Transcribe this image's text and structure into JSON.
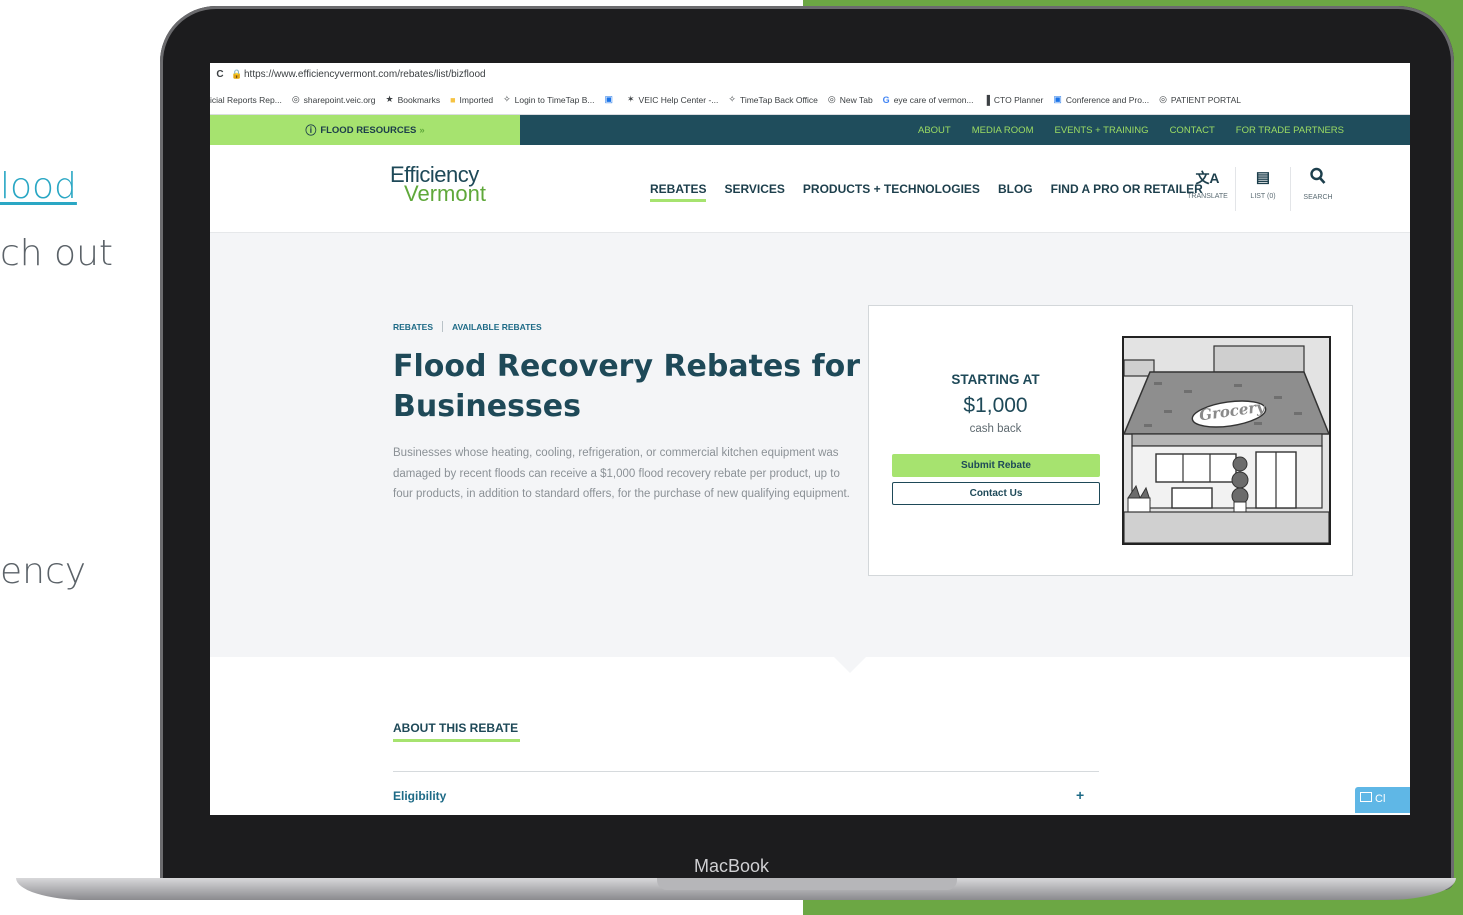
{
  "slide": {
    "line1": "lood",
    "line2": "ch out",
    "line3": "ency",
    "colors": {
      "accent": "#6ca744",
      "link": "#2aa7c4"
    }
  },
  "device": {
    "label": "MacBook"
  },
  "browser": {
    "url": "https://www.efficiencyvermont.com/rebates/list/bizflood",
    "bookmarks": [
      {
        "icon": "",
        "label": "icial Reports Rep..."
      },
      {
        "icon": "globe-icon",
        "label": "sharepoint.veic.org"
      },
      {
        "icon": "star-icon",
        "label": "Bookmarks"
      },
      {
        "icon": "folder-icon",
        "label": "Imported"
      },
      {
        "icon": "timetap-icon",
        "label": "Login to TimeTap B..."
      },
      {
        "icon": "app-icon",
        "label": ""
      },
      {
        "icon": "help-icon",
        "label": "VEIC Help Center -..."
      },
      {
        "icon": "timetap-icon",
        "label": "TimeTap Back Office"
      },
      {
        "icon": "globe-icon",
        "label": "New Tab"
      },
      {
        "icon": "google-icon",
        "label": "eye care of vermon..."
      },
      {
        "icon": "chart-icon",
        "label": "CTO Planner"
      },
      {
        "icon": "app-icon",
        "label": "Conference and Pro..."
      },
      {
        "icon": "globe-icon",
        "label": "PATIENT PORTAL"
      }
    ]
  },
  "site": {
    "flood_banner": "FLOOD RESOURCES",
    "utility_links": [
      "ABOUT",
      "MEDIA ROOM",
      "EVENTS + TRAINING",
      "CONTACT",
      "FOR TRADE PARTNERS"
    ],
    "logo": {
      "line1": "Efficiency",
      "line2": "Vermont"
    },
    "nav": [
      "REBATES",
      "SERVICES",
      "PRODUCTS + TECHNOLOGIES",
      "BLOG",
      "FIND A PRO OR RETAILER"
    ],
    "tools": [
      {
        "icon": "translate-icon",
        "label": "TRANSLATE"
      },
      {
        "icon": "clipboard-icon",
        "label": "LIST (0)"
      },
      {
        "icon": "search-icon",
        "label": "SEARCH"
      }
    ],
    "breadcrumb": [
      "REBATES",
      "AVAILABLE REBATES"
    ],
    "hero": {
      "title": "Flood Recovery Rebates for Businesses",
      "description": "Businesses whose heating, cooling, refrigeration, or commercial kitchen equipment was damaged by recent floods can receive a $1,000 flood recovery rebate per product, up to four products, in addition to standard offers, for the purchase of new qualifying equipment."
    },
    "card": {
      "starting_label": "STARTING AT",
      "price": "$1,000",
      "price_note": "cash back",
      "submit_label": "Submit Rebate",
      "contact_label": "Contact Us",
      "store_sign": "Grocery"
    },
    "about_heading": "ABOUT THIS REBATE",
    "accordion": [
      {
        "label": "Eligibility",
        "toggle": "+"
      }
    ],
    "chat_label": "Cl",
    "colors": {
      "navy": "#1e4958",
      "lime": "#a6e36f",
      "teal": "#1d6a86",
      "utility_bg": "#1f4d5c"
    }
  }
}
